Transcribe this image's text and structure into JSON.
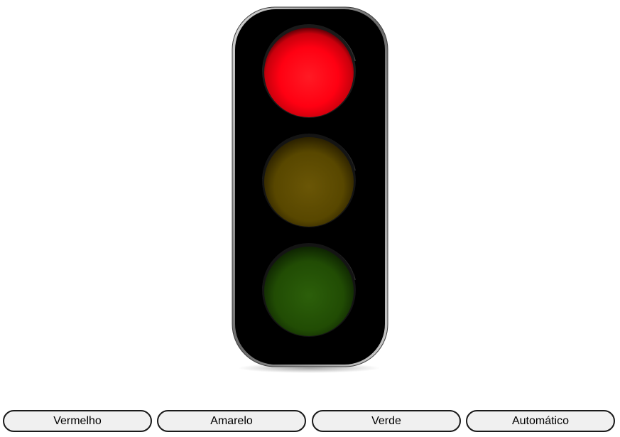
{
  "traffic_light": {
    "lamps": [
      {
        "color": "red",
        "state": "on",
        "fill": "#ff0012"
      },
      {
        "color": "yellow",
        "state": "off",
        "fill": "#5a4a00"
      },
      {
        "color": "green",
        "state": "off",
        "fill": "#1f4a00"
      }
    ],
    "housing_color": "#000000"
  },
  "controls": {
    "red_label": "Vermelho",
    "yellow_label": "Amarelo",
    "green_label": "Verde",
    "auto_label": "Automático"
  }
}
